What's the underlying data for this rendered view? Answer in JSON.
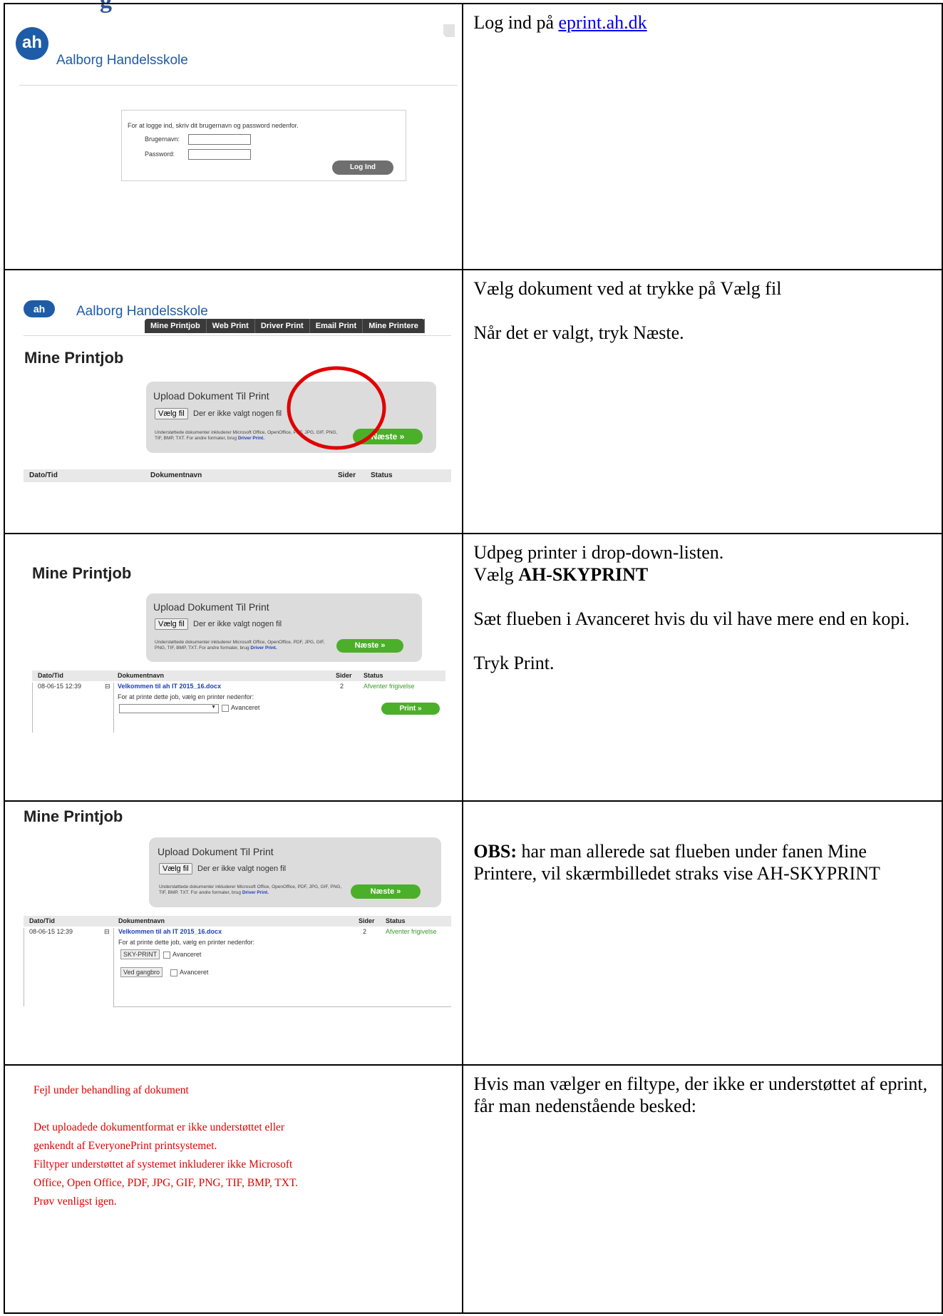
{
  "page_title_fragment": "g",
  "rows": [
    {
      "instruction_prefix": "Log ind på ",
      "instruction_link": "eprint.ah.dk",
      "shot": {
        "logo": "ah",
        "brand": "Aalborg Handelsskole",
        "intro": "For at logge ind, skriv dit brugernavn og password nedenfor.",
        "username_label": "Brugernavn:",
        "password_label": "Password:",
        "login_button": "Log Ind"
      }
    },
    {
      "instruction_lines": [
        "Vælg dokument ved at trykke på Vælg fil",
        "",
        "Når det er valgt, tryk Næste."
      ],
      "shot": {
        "brand": "Aalborg Handelsskole",
        "nav": [
          "Mine Printjob",
          "Web Print",
          "Driver Print",
          "Email Print",
          "Mine Printere"
        ],
        "heading": "Mine Printjob",
        "upload_title": "Upload Dokument Til Print",
        "file_button": "Vælg fil",
        "no_file": "Der er ikke valgt nogen fil",
        "support_text": "Understøttede dokumenter inkluderer Microsoft Office, OpenOffice, PDF, JPG, GIF, PNG, TIF, BMP, TXT. For andre formater, brug ",
        "support_link": "Driver Print.",
        "next_button": "Næste »",
        "col_date": "Dato/Tid",
        "col_doc": "Dokumentnavn",
        "col_pages": "Sider",
        "col_status": "Status"
      }
    },
    {
      "instruction_line1": "Udpeg printer i drop-down-listen.",
      "instruction_line2_prefix": "Vælg ",
      "instruction_line2_bold": "AH-SKYPRINT",
      "instruction_line3": "Sæt flueben i Avanceret hvis du vil have mere end en kopi.",
      "instruction_line4": "Tryk Print.",
      "shot": {
        "heading": "Mine Printjob",
        "upload_title": "Upload Dokument Til Print",
        "file_button": "Vælg fil",
        "no_file": "Der er ikke valgt nogen fil",
        "support_text": "Understøttede dokumenter inkluderer Microsoft Office, OpenOffice, PDF, JPG, GIF, PNG, TIF, BMP, TXT. For andre formater, brug ",
        "support_link": "Driver Print.",
        "next_button": "Næste »",
        "col_date": "Dato/Tid",
        "col_doc": "Dokumentnavn",
        "col_pages": "Sider",
        "col_status": "Status",
        "job_date": "08-06-15 12:39",
        "job_name": "Velkommen til ah IT 2015_16.docx",
        "job_pages": "2",
        "job_status": "Afventer frigivelse",
        "choose_printer": "For at printe dette job, vælg en printer nedenfor:",
        "advanced": "Avanceret",
        "print_button": "Print »"
      }
    },
    {
      "instruction_bold": "OBS:",
      "instruction_rest": " har man allerede sat flueben under fanen Mine Printere, vil skærmbilledet straks vise AH-SKYPRINT",
      "shot": {
        "heading": "Mine Printjob",
        "upload_title": "Upload Dokument Til Print",
        "file_button": "Vælg fil",
        "no_file": "Der er ikke valgt nogen fil",
        "support_text": "Understøttede dokumenter inkluderer Microsoft Office, OpenOffice, PDF, JPG, GIF, PNG, TIF, BMP, TXT. For andre formater, brug ",
        "support_link": "Driver Print.",
        "next_button": "Næste »",
        "col_date": "Dato/Tid",
        "col_doc": "Dokumentnavn",
        "col_pages": "Sider",
        "col_status": "Status",
        "job_date": "08-06-15 12:39",
        "job_name": "Velkommen til ah IT 2015_16.docx",
        "job_pages": "2",
        "job_status": "Afventer frigivelse",
        "choose_printer": "For at printe dette job, vælg en printer nedenfor:",
        "printer1": "SKY-PRINT",
        "printer2": "Ved gangbro",
        "advanced": "Avanceret"
      }
    },
    {
      "instruction": "Hvis man vælger en filtype, der ikke er understøttet af eprint, får man nedenstående besked:",
      "shot": {
        "error_lines": [
          "Fejl under behandling af dokument",
          "",
          "Det uploadede dokumentformat er ikke understøttet eller",
          "genkendt af EveryonePrint printsystemet.",
          "Filtyper understøttet af systemet inkluderer ikke Microsoft",
          "Office, Open Office, PDF, JPG, GIF, PNG, TIF, BMP, TXT.",
          "Prøv venligst igen."
        ]
      }
    }
  ]
}
